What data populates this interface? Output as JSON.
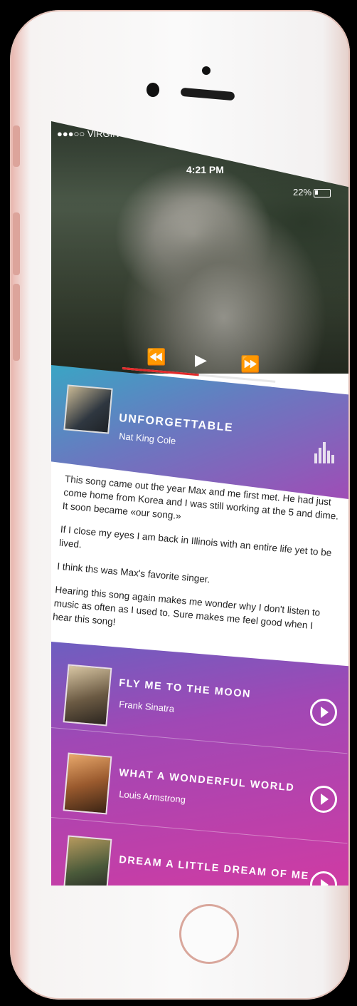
{
  "status_bar": {
    "carrier": "●●●○○ VIRGIN",
    "time": "4:21 PM",
    "battery": "22%"
  },
  "player": {
    "progress": 0.5,
    "controls": {
      "rewind_icon": "⏪",
      "play_icon": "▶",
      "forward_icon": "⏩"
    }
  },
  "now_playing": {
    "title": "UNFORGETTABLE",
    "artist": "Nat King Cole"
  },
  "story": {
    "paragraphs": [
      "This song came out the year Max and me first met. He had just come home from Korea and I was still working at the 5 and dime. It soon became «our song.»",
      "If I close my eyes I am back in Illinois with an entire life yet to be lived.",
      "I think ths was Max's favorite singer.",
      "Hearing this song again makes me wonder why I don't listen to music as often as I used to.  Sure makes me feel good when I hear this song!"
    ]
  },
  "songs": [
    {
      "title": "FLY ME TO THE MOON",
      "artist": "Frank Sinatra"
    },
    {
      "title": "WHAT A WONDERFUL WORLD",
      "artist": "Louis Armstrong"
    },
    {
      "title": "DREAM A LITTLE DREAM OF ME",
      "artist": ""
    }
  ],
  "colors": {
    "banner_start": "#3aa5c4",
    "banner_end": "#9f4db6",
    "list_start": "#6d5fc0",
    "list_end": "#cf3ba3",
    "progress_red": "#e22a2a"
  }
}
